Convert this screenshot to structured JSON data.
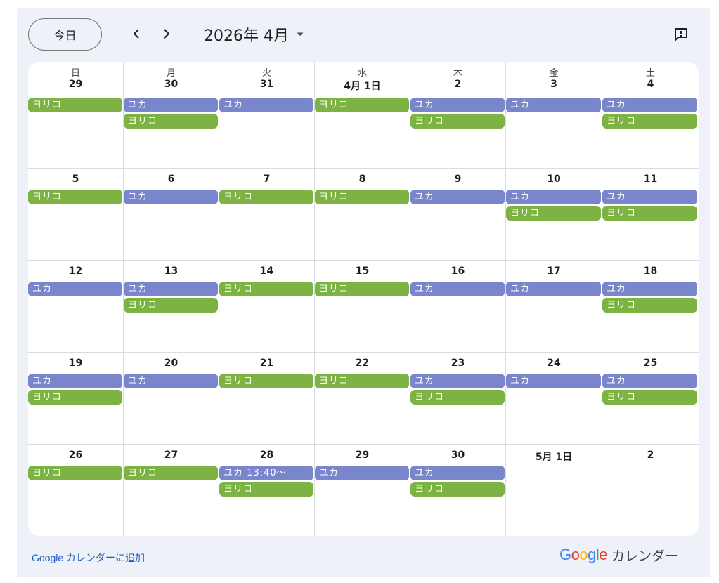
{
  "toolbar": {
    "today_label": "今日",
    "month_title": "2026年 4月"
  },
  "weekdays": [
    "日",
    "月",
    "火",
    "水",
    "木",
    "金",
    "土"
  ],
  "weeks": [
    [
      {
        "day": "29",
        "events": [
          {
            "title": "ヨリコ",
            "color": "#7cb342"
          }
        ]
      },
      {
        "day": "30",
        "events": [
          {
            "title": "ユカ",
            "color": "#7986cb"
          },
          {
            "title": "ヨリコ",
            "color": "#7cb342"
          }
        ]
      },
      {
        "day": "31",
        "events": [
          {
            "title": "ユカ",
            "color": "#7986cb"
          }
        ]
      },
      {
        "day": "4月 1日",
        "events": [
          {
            "title": "ヨリコ",
            "color": "#7cb342"
          }
        ]
      },
      {
        "day": "2",
        "events": [
          {
            "title": "ユカ",
            "color": "#7986cb"
          },
          {
            "title": "ヨリコ",
            "color": "#7cb342"
          }
        ]
      },
      {
        "day": "3",
        "events": [
          {
            "title": "ユカ",
            "color": "#7986cb"
          }
        ]
      },
      {
        "day": "4",
        "events": [
          {
            "title": "ユカ",
            "color": "#7986cb"
          },
          {
            "title": "ヨリコ",
            "color": "#7cb342"
          }
        ]
      }
    ],
    [
      {
        "day": "5",
        "events": [
          {
            "title": "ヨリコ",
            "color": "#7cb342"
          }
        ]
      },
      {
        "day": "6",
        "events": [
          {
            "title": "ユカ",
            "color": "#7986cb"
          }
        ]
      },
      {
        "day": "7",
        "events": [
          {
            "title": "ヨリコ",
            "color": "#7cb342"
          }
        ]
      },
      {
        "day": "8",
        "events": [
          {
            "title": "ヨリコ",
            "color": "#7cb342"
          }
        ]
      },
      {
        "day": "9",
        "events": [
          {
            "title": "ユカ",
            "color": "#7986cb"
          }
        ]
      },
      {
        "day": "10",
        "events": [
          {
            "title": "ユカ",
            "color": "#7986cb"
          },
          {
            "title": "ヨリコ",
            "color": "#7cb342"
          }
        ]
      },
      {
        "day": "11",
        "events": [
          {
            "title": "ユカ",
            "color": "#7986cb"
          },
          {
            "title": "ヨリコ",
            "color": "#7cb342"
          }
        ]
      }
    ],
    [
      {
        "day": "12",
        "events": [
          {
            "title": "ユカ",
            "color": "#7986cb"
          }
        ]
      },
      {
        "day": "13",
        "events": [
          {
            "title": "ユカ",
            "color": "#7986cb"
          },
          {
            "title": "ヨリコ",
            "color": "#7cb342"
          }
        ]
      },
      {
        "day": "14",
        "events": [
          {
            "title": "ヨリコ",
            "color": "#7cb342"
          }
        ]
      },
      {
        "day": "15",
        "events": [
          {
            "title": "ヨリコ",
            "color": "#7cb342"
          }
        ]
      },
      {
        "day": "16",
        "events": [
          {
            "title": "ユカ",
            "color": "#7986cb"
          }
        ]
      },
      {
        "day": "17",
        "events": [
          {
            "title": "ユカ",
            "color": "#7986cb"
          }
        ]
      },
      {
        "day": "18",
        "events": [
          {
            "title": "ユカ",
            "color": "#7986cb"
          },
          {
            "title": "ヨリコ",
            "color": "#7cb342"
          }
        ]
      }
    ],
    [
      {
        "day": "19",
        "events": [
          {
            "title": "ユカ",
            "color": "#7986cb"
          },
          {
            "title": "ヨリコ",
            "color": "#7cb342"
          }
        ]
      },
      {
        "day": "20",
        "events": [
          {
            "title": "ユカ",
            "color": "#7986cb"
          }
        ]
      },
      {
        "day": "21",
        "events": [
          {
            "title": "ヨリコ",
            "color": "#7cb342"
          }
        ]
      },
      {
        "day": "22",
        "events": [
          {
            "title": "ヨリコ",
            "color": "#7cb342"
          }
        ]
      },
      {
        "day": "23",
        "events": [
          {
            "title": "ユカ",
            "color": "#7986cb"
          },
          {
            "title": "ヨリコ",
            "color": "#7cb342"
          }
        ]
      },
      {
        "day": "24",
        "events": [
          {
            "title": "ユカ",
            "color": "#7986cb"
          }
        ]
      },
      {
        "day": "25",
        "events": [
          {
            "title": "ユカ",
            "color": "#7986cb"
          },
          {
            "title": "ヨリコ",
            "color": "#7cb342"
          }
        ]
      }
    ],
    [
      {
        "day": "26",
        "events": [
          {
            "title": "ヨリコ",
            "color": "#7cb342"
          }
        ]
      },
      {
        "day": "27",
        "events": [
          {
            "title": "ヨリコ",
            "color": "#7cb342"
          }
        ]
      },
      {
        "day": "28",
        "events": [
          {
            "title": "ユカ 13:40～",
            "color": "#7986cb"
          },
          {
            "title": "ヨリコ",
            "color": "#7cb342"
          }
        ]
      },
      {
        "day": "29",
        "events": [
          {
            "title": "ユカ",
            "color": "#7986cb"
          }
        ]
      },
      {
        "day": "30",
        "events": [
          {
            "title": "ユカ",
            "color": "#7986cb"
          },
          {
            "title": "ヨリコ",
            "color": "#7cb342"
          }
        ]
      },
      {
        "day": "5月 1日",
        "events": []
      },
      {
        "day": "2",
        "events": []
      }
    ]
  ],
  "footer": {
    "add_link": "Google カレンダーに追加",
    "brand_word": "Google",
    "brand_text": "カレンダー",
    "brand_colors": [
      "#4285f4",
      "#ea4335",
      "#fbbc05",
      "#4285f4",
      "#34a853",
      "#ea4335"
    ]
  }
}
